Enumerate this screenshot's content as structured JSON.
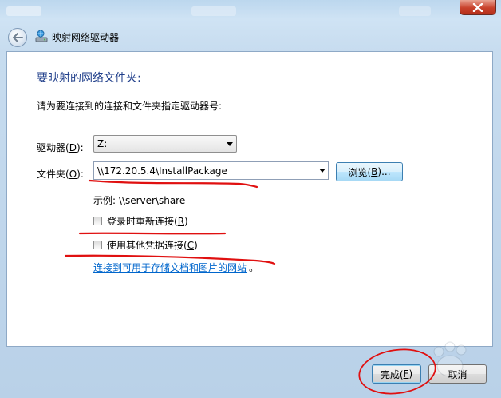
{
  "window": {
    "title": "映射网络驱动器"
  },
  "heading": "要映射的网络文件夹:",
  "instruction": "请为要连接到的连接和文件夹指定驱动器号:",
  "drive": {
    "label_pre": "驱动器(",
    "label_key": "D",
    "label_post": "):",
    "value": "Z:"
  },
  "folder": {
    "label_pre": "文件夹(",
    "label_key": "O",
    "label_post": "):",
    "value": "\\\\172.20.5.4\\InstallPackage"
  },
  "browse": {
    "pre": "浏览(",
    "key": "B",
    "post": ")..."
  },
  "example": "示例: \\\\server\\share",
  "reconnect": {
    "pre": "登录时重新连接(",
    "key": "R",
    "post": ")",
    "checked": false
  },
  "other_credentials": {
    "pre": "使用其他凭据连接(",
    "key": "C",
    "post": ")",
    "checked": false
  },
  "link": {
    "text": "连接到可用于存储文档和图片的网站",
    "suffix": "。"
  },
  "buttons": {
    "finish": {
      "pre": "完成(",
      "key": "F",
      "post": ")"
    },
    "cancel": "取消"
  },
  "annotation_color": "#e01010",
  "link_color": "#0066cc",
  "heading_color": "#1f3e8a"
}
